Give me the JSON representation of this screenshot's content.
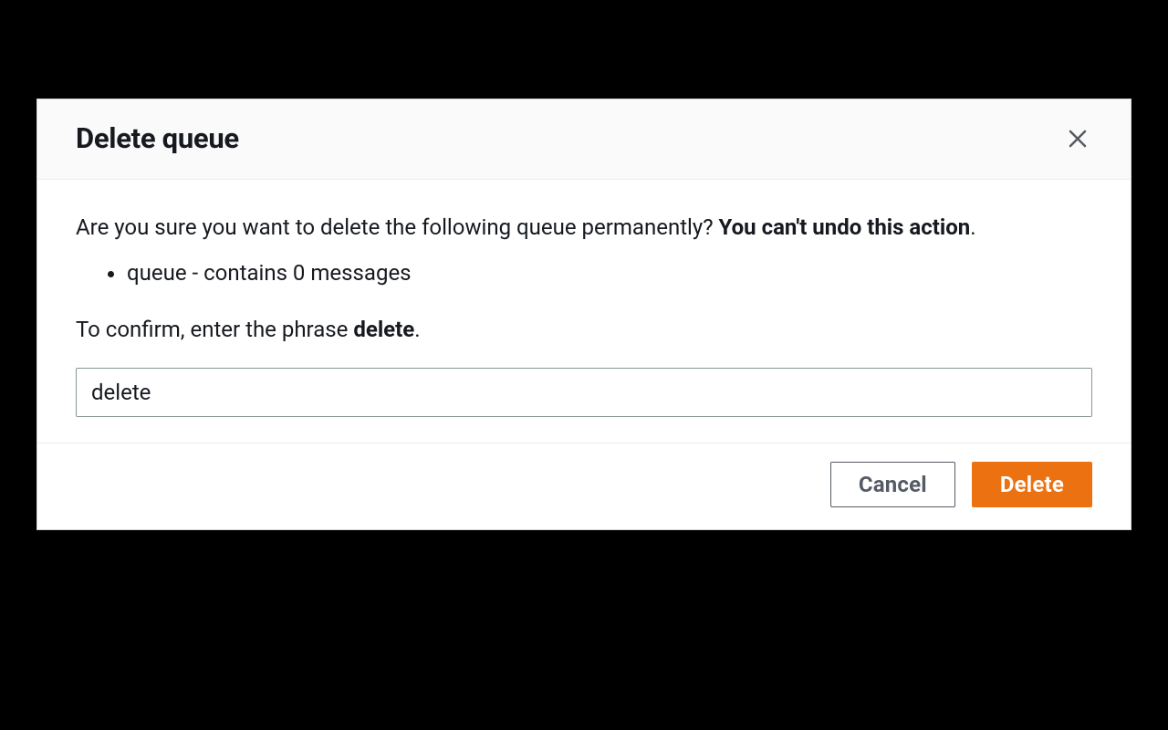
{
  "modal": {
    "title": "Delete queue",
    "warning_prefix": "Are you sure you want to delete the following queue permanently? ",
    "warning_bold": "You can't undo this action",
    "warning_suffix": ".",
    "queue_item": "queue - contains 0 messages",
    "confirm_prefix": "To confirm, enter the phrase ",
    "confirm_bold": "delete",
    "confirm_suffix": ".",
    "input_value": "delete",
    "cancel_label": "Cancel",
    "delete_label": "Delete"
  }
}
